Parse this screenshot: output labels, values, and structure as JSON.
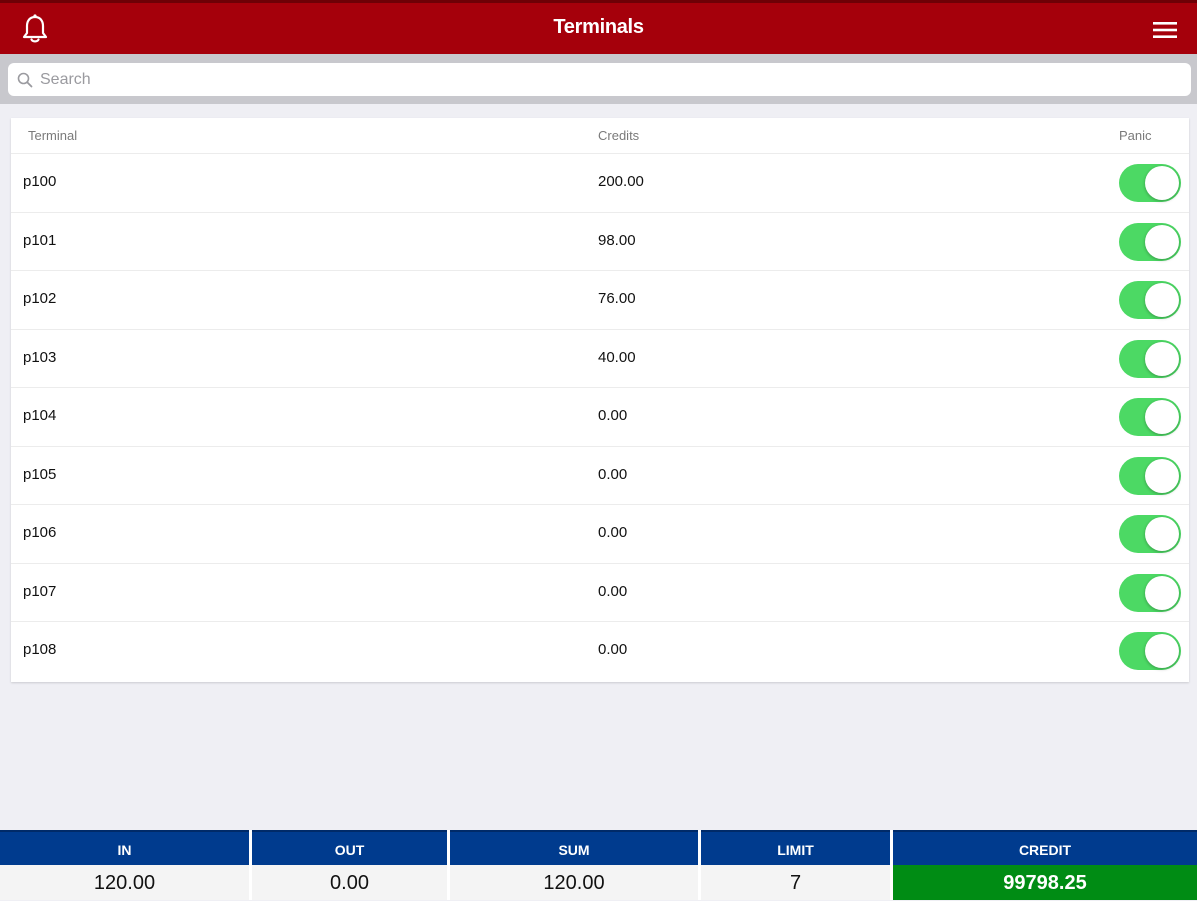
{
  "header": {
    "title": "Terminals",
    "left_icon": "bell-icon",
    "right_icon": "hamburger-menu-icon",
    "background_color": "#a5000b"
  },
  "search": {
    "placeholder": "Search",
    "value": ""
  },
  "table": {
    "columns": [
      "Terminal",
      "Credits",
      "Panic"
    ],
    "rows": [
      {
        "terminal": "p100",
        "credits": "200.00",
        "panic": true
      },
      {
        "terminal": "p101",
        "credits": "98.00",
        "panic": true
      },
      {
        "terminal": "p102",
        "credits": "76.00",
        "panic": true
      },
      {
        "terminal": "p103",
        "credits": "40.00",
        "panic": true
      },
      {
        "terminal": "p104",
        "credits": "0.00",
        "panic": true
      },
      {
        "terminal": "p105",
        "credits": "0.00",
        "panic": true
      },
      {
        "terminal": "p106",
        "credits": "0.00",
        "panic": true
      },
      {
        "terminal": "p107",
        "credits": "0.00",
        "panic": true
      },
      {
        "terminal": "p108",
        "credits": "0.00",
        "panic": true
      }
    ],
    "toggle_on_color": "#4cd964"
  },
  "footer": {
    "header_color": "#003b8e",
    "credit_color": "#008c14",
    "cells": [
      {
        "label": "IN",
        "value": "120.00"
      },
      {
        "label": "OUT",
        "value": "0.00"
      },
      {
        "label": "SUM",
        "value": "120.00"
      },
      {
        "label": "LIMIT",
        "value": "7"
      },
      {
        "label": "CREDIT",
        "value": "99798.25"
      }
    ]
  }
}
